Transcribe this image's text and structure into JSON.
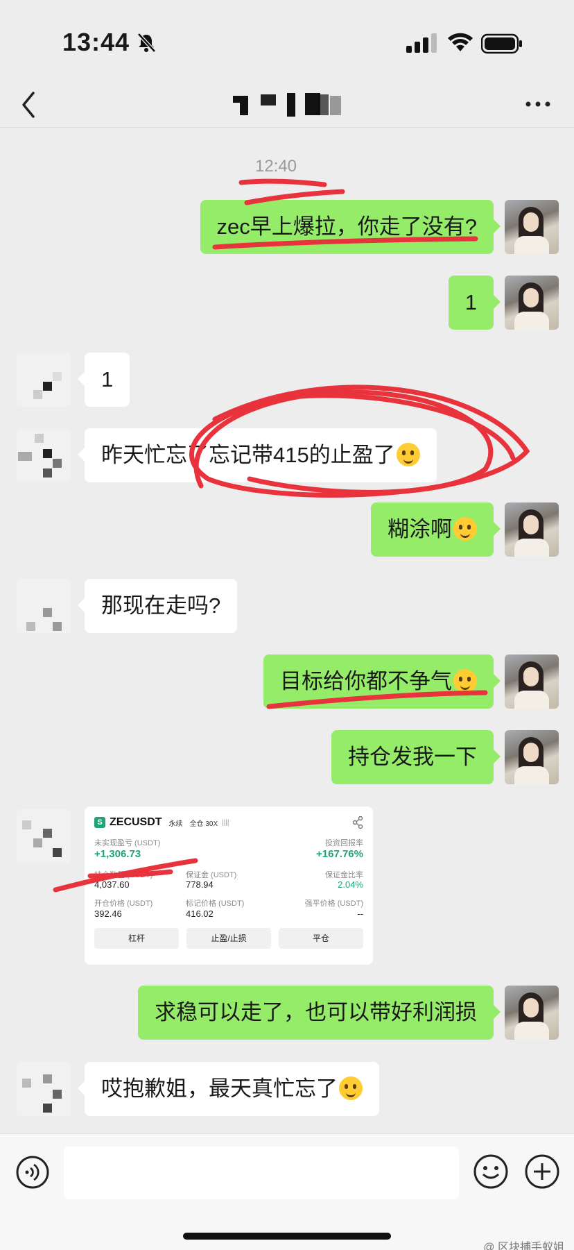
{
  "status_bar": {
    "time": "13:44"
  },
  "nav": {
    "back_icon": "chevron-left-icon",
    "more_icon": "ellipsis-icon",
    "title": ""
  },
  "chat": {
    "timestamp": "12:40",
    "messages": [
      {
        "side": "right",
        "text": "zec早上爆拉，你走了没有?"
      },
      {
        "side": "right",
        "text": "1"
      },
      {
        "side": "left",
        "text": "1"
      },
      {
        "side": "left",
        "text": "昨天忙忘了忘记带415的止盈了",
        "emoji": "drooling-face"
      },
      {
        "side": "right",
        "text": "糊涂啊",
        "emoji": "woozy-face"
      },
      {
        "side": "left",
        "text": "那现在走吗?"
      },
      {
        "side": "right",
        "text": "目标给你都不争气",
        "emoji": "weary-face"
      },
      {
        "side": "right",
        "text": "持仓发我一下"
      },
      {
        "side": "right",
        "text": "求稳可以走了，也可以带好利润损"
      },
      {
        "side": "left",
        "text": "哎抱歉姐，最天真忙忘了",
        "emoji": "crying-face"
      }
    ],
    "position_card": {
      "symbol": "ZECUSDT",
      "tag_perpetual": "永续",
      "tag_margin": "全仓 30X",
      "tag_bars": "||||",
      "pnl_label": "未实现盈亏 (USDT)",
      "pnl_value": "+1,306.73",
      "roi_label": "投资回报率",
      "roi_value": "+167.76%",
      "qty_label": "持仓数量 (USDT)",
      "qty_value": "4,037.60",
      "margin_label": "保证金 (USDT)",
      "margin_value": "778.94",
      "margin_ratio_label": "保证金比率",
      "margin_ratio_value": "2.04%",
      "entry_label": "开仓价格 (USDT)",
      "entry_value": "392.46",
      "mark_label": "标记价格 (USDT)",
      "mark_value": "416.02",
      "liq_label": "强平价格 (USDT)",
      "liq_value": "--",
      "btn_leverage": "杠杆",
      "btn_tpsl": "止盈/止损",
      "btn_close": "平仓"
    }
  },
  "input_bar": {
    "voice_icon": "voice-icon",
    "emoji_icon": "emoji-icon",
    "plus_icon": "plus-icon"
  },
  "watermark": "@ 区块捕手蚁姐",
  "colors": {
    "bubble_right": "#95ec69",
    "bubble_left": "#ffffff",
    "background": "#ededed",
    "annotation": "#e8333d"
  }
}
